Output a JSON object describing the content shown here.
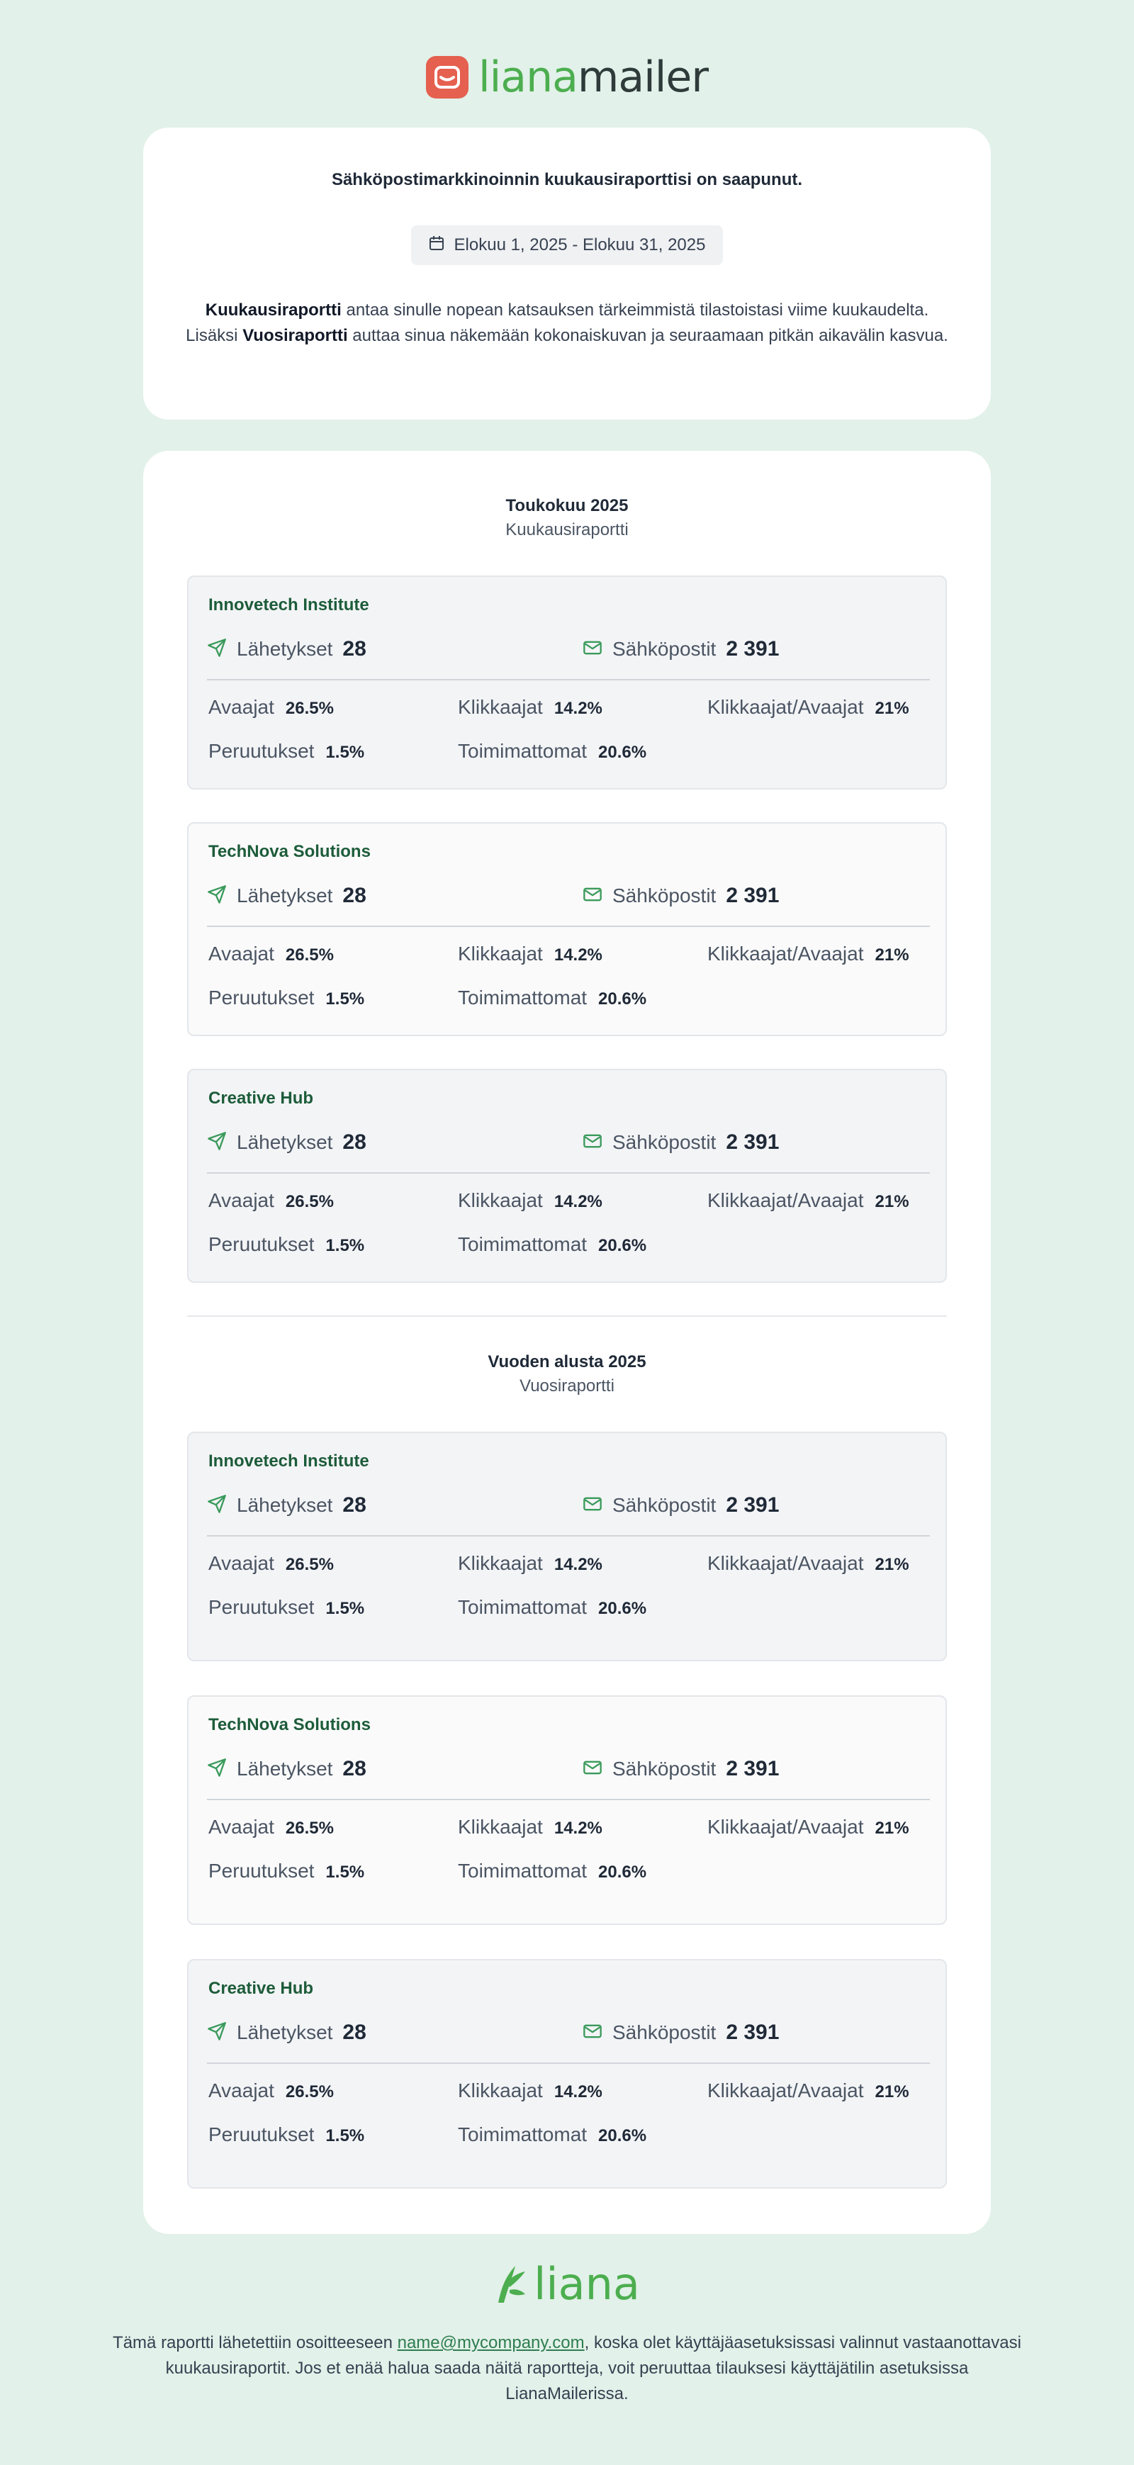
{
  "brand": {
    "logo_part1": "liana",
    "logo_part2": "mailer",
    "footer_logo": "liana",
    "colors": {
      "background": "#e2f1e9",
      "brand_red": "#e5604f",
      "brand_green": "#4cae4f",
      "org_name": "#1d5c3a"
    }
  },
  "intro": {
    "heading": "Sähköpostimarkkinoinnin kuukausiraporttisi on saapunut.",
    "date_icon": "calendar-icon",
    "date_range": "Elokuu 1, 2025 - Elokuu 31, 2025",
    "text_bold1": "Kuukausiraportti",
    "text_part1": " antaa sinulle nopean katsauksen tärkeimmistä tilastoistasi viime kuukaudelta. Lisäksi ",
    "text_bold2": "Vuosiraportti",
    "text_part2": " auttaa sinua näkemään kokonaiskuvan ja seuraamaan pitkän aikavälin kasvua."
  },
  "sections": [
    {
      "title": "Toukokuu 2025",
      "subtitle": "Kuukausiraportti",
      "orgs": [
        {
          "name": "Innovetech Institute",
          "sends_label": "Lähetykset",
          "sends": "28",
          "emails_label": "Sähköpostit",
          "emails": "2 391",
          "open_label": "Avaajat",
          "open": "26.5%",
          "click_label": "Klikkaajat",
          "click": "14.2%",
          "ctor_label": "Klikkaajat/Avaajat",
          "ctor": "21%",
          "unsub_label": "Peruutukset",
          "unsub": "1.5%",
          "inactive_label": "Toimimattomat",
          "inactive": "20.6%"
        },
        {
          "name": "TechNova Solutions",
          "sends_label": "Lähetykset",
          "sends": "28",
          "emails_label": "Sähköpostit",
          "emails": "2 391",
          "open_label": "Avaajat",
          "open": "26.5%",
          "click_label": "Klikkaajat",
          "click": "14.2%",
          "ctor_label": "Klikkaajat/Avaajat",
          "ctor": "21%",
          "unsub_label": "Peruutukset",
          "unsub": "1.5%",
          "inactive_label": "Toimimattomat",
          "inactive": "20.6%"
        },
        {
          "name": "Creative Hub",
          "sends_label": "Lähetykset",
          "sends": "28",
          "emails_label": "Sähköpostit",
          "emails": "2 391",
          "open_label": "Avaajat",
          "open": "26.5%",
          "click_label": "Klikkaajat",
          "click": "14.2%",
          "ctor_label": "Klikkaajat/Avaajat",
          "ctor": "21%",
          "unsub_label": "Peruutukset",
          "unsub": "1.5%",
          "inactive_label": "Toimimattomat",
          "inactive": "20.6%"
        }
      ]
    },
    {
      "title": "Vuoden alusta 2025",
      "subtitle": "Vuosiraportti",
      "orgs": [
        {
          "name": "Innovetech Institute",
          "sends_label": "Lähetykset",
          "sends": "28",
          "emails_label": "Sähköpostit",
          "emails": "2 391",
          "open_label": "Avaajat",
          "open": "26.5%",
          "click_label": "Klikkaajat",
          "click": "14.2%",
          "ctor_label": "Klikkaajat/Avaajat",
          "ctor": "21%",
          "unsub_label": "Peruutukset",
          "unsub": "1.5%",
          "inactive_label": "Toimimattomat",
          "inactive": "20.6%"
        },
        {
          "name": "TechNova Solutions",
          "sends_label": "Lähetykset",
          "sends": "28",
          "emails_label": "Sähköpostit",
          "emails": "2 391",
          "open_label": "Avaajat",
          "open": "26.5%",
          "click_label": "Klikkaajat",
          "click": "14.2%",
          "ctor_label": "Klikkaajat/Avaajat",
          "ctor": "21%",
          "unsub_label": "Peruutukset",
          "unsub": "1.5%",
          "inactive_label": "Toimimattomat",
          "inactive": "20.6%"
        },
        {
          "name": "Creative Hub",
          "sends_label": "Lähetykset",
          "sends": "28",
          "emails_label": "Sähköpostit",
          "emails": "2 391",
          "open_label": "Avaajat",
          "open": "26.5%",
          "click_label": "Klikkaajat",
          "click": "14.2%",
          "ctor_label": "Klikkaajat/Avaajat",
          "ctor": "21%",
          "unsub_label": "Peruutukset",
          "unsub": "1.5%",
          "inactive_label": "Toimimattomat",
          "inactive": "20.6%"
        }
      ]
    }
  ],
  "footer": {
    "text_part1": "Tämä raportti lähetettiin osoitteeseen ",
    "email": "name@mycompany.com",
    "text_part2": ", koska olet käyttäjäasetuksissasi valinnut vastaanottavasi kuukausiraportit. Jos et enää halua saada näitä raportteja, voit peruuttaa tilauksesi käyttäjätilin asetuksissa LianaMailerissa."
  }
}
